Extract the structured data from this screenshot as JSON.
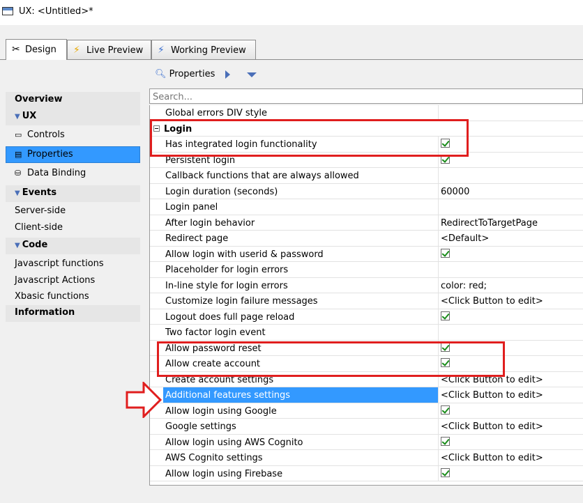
{
  "window": {
    "title": "UX: <Untitled>*"
  },
  "tabs": [
    {
      "label": "Design",
      "icon": "tools-icon"
    },
    {
      "label": "Live Preview",
      "icon": "lightning-icon"
    },
    {
      "label": "Working Preview",
      "icon": "lightning-icon"
    }
  ],
  "toolbar": {
    "properties_label": "Properties"
  },
  "sidebar": {
    "items": [
      {
        "label": "Overview",
        "kind": "header"
      },
      {
        "label": "UX",
        "kind": "group"
      },
      {
        "label": "Controls",
        "kind": "item"
      },
      {
        "label": "Properties",
        "kind": "item"
      },
      {
        "label": "Data Binding",
        "kind": "item"
      },
      {
        "label": "Events",
        "kind": "group"
      },
      {
        "label": "Server-side",
        "kind": "sub"
      },
      {
        "label": "Client-side",
        "kind": "sub"
      },
      {
        "label": "Code",
        "kind": "group"
      },
      {
        "label": "Javascript functions",
        "kind": "sub"
      },
      {
        "label": "Javascript Actions",
        "kind": "sub"
      },
      {
        "label": "Xbasic functions",
        "kind": "sub"
      },
      {
        "label": "Information",
        "kind": "header"
      }
    ]
  },
  "search": {
    "placeholder": "Search..."
  },
  "properties": {
    "rows": [
      {
        "name": "Global errors DIV style",
        "value": ""
      },
      {
        "name": "Login",
        "value": ""
      },
      {
        "name": "Has integrated login functionality",
        "value": "checked"
      },
      {
        "name": "Persistent login",
        "value": "checked"
      },
      {
        "name": "Callback functions that are always allowed",
        "value": ""
      },
      {
        "name": "Login duration (seconds)",
        "value": "60000"
      },
      {
        "name": "Login panel",
        "value": ""
      },
      {
        "name": "After login behavior",
        "value": "RedirectToTargetPage"
      },
      {
        "name": "Redirect page",
        "value": "<Default>"
      },
      {
        "name": "Allow login with userid & password",
        "value": "checked"
      },
      {
        "name": "Placeholder for login errors",
        "value": ""
      },
      {
        "name": "In-line style for login errors",
        "value": "color: red;"
      },
      {
        "name": "Customize login failure messages",
        "value": "<Click Button to edit>"
      },
      {
        "name": "Logout does full page reload",
        "value": "checked"
      },
      {
        "name": "Two factor login event",
        "value": ""
      },
      {
        "name": "Allow password reset",
        "value": "checked"
      },
      {
        "name": "Allow create account",
        "value": "checked"
      },
      {
        "name": "Create account settings",
        "value": "<Click Button to edit>"
      },
      {
        "name": "Additional features settings",
        "value": "<Click Button to edit>"
      },
      {
        "name": "Allow login using Google",
        "value": "checked"
      },
      {
        "name": "Google settings",
        "value": "<Click Button to edit>"
      },
      {
        "name": "Allow login using AWS Cognito",
        "value": "checked"
      },
      {
        "name": "AWS Cognito settings",
        "value": "<Click Button to edit>"
      },
      {
        "name": "Allow login using Firebase",
        "value": "checked"
      }
    ]
  },
  "colors": {
    "highlight_box": "#e01e1e",
    "selection": "#3399ff",
    "accent": "#4a6fb8"
  }
}
